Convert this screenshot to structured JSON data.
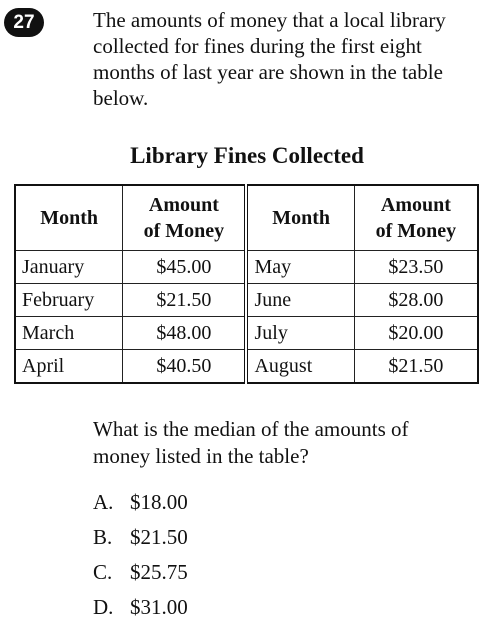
{
  "question": {
    "number": "27",
    "stem": "The amounts of money that a local library collected for fines during the first eight months of last year are shown in the table below."
  },
  "table": {
    "title": "Library Fines Collected",
    "headers": {
      "month": "Month",
      "amount_line1": "Amount",
      "amount_line2": "of Money"
    },
    "rows": [
      {
        "month_a": "January",
        "amount_a": "$45.00",
        "month_b": "May",
        "amount_b": "$23.50"
      },
      {
        "month_a": "February",
        "amount_a": "$21.50",
        "month_b": "June",
        "amount_b": "$28.00"
      },
      {
        "month_a": "March",
        "amount_a": "$48.00",
        "month_b": "July",
        "amount_b": "$20.00"
      },
      {
        "month_a": "April",
        "amount_a": "$40.50",
        "month_b": "August",
        "amount_b": "$21.50"
      }
    ]
  },
  "prompt": "What is the median of the amounts of money listed in the table?",
  "choices": [
    {
      "letter": "A.",
      "text": "$18.00"
    },
    {
      "letter": "B.",
      "text": "$21.50"
    },
    {
      "letter": "C.",
      "text": "$25.75"
    },
    {
      "letter": "D.",
      "text": "$31.00"
    }
  ]
}
